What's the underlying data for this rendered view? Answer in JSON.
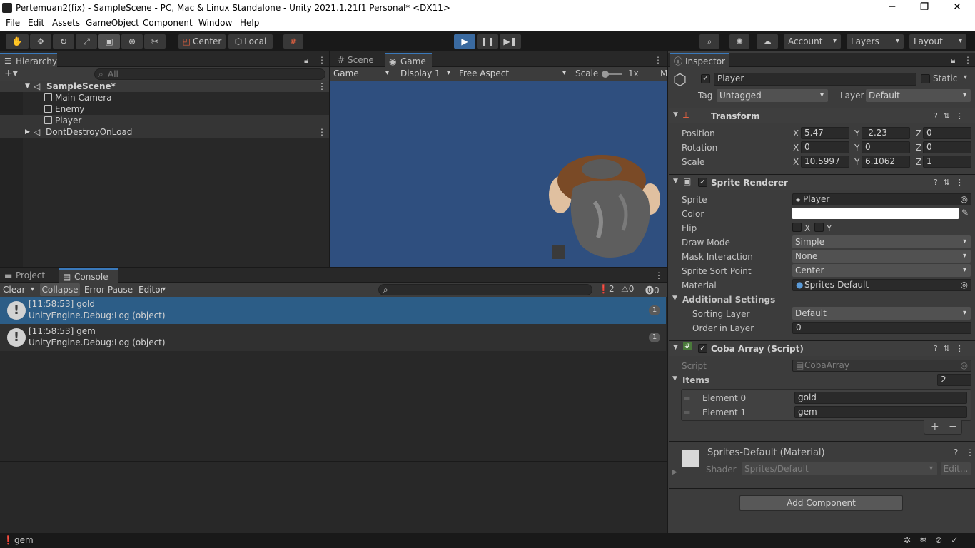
{
  "window": {
    "title": "Pertemuan2(fix) - SampleScene - PC, Mac & Linux Standalone - Unity 2021.1.21f1 Personal* <DX11>",
    "minimize": "─",
    "maximize": "❐",
    "close": "✕"
  },
  "menu": [
    "File",
    "Edit",
    "Assets",
    "GameObject",
    "Component",
    "Window",
    "Help"
  ],
  "toolbar": {
    "center": "Center",
    "local": "Local",
    "account": "Account",
    "layers": "Layers",
    "layout": "Layout"
  },
  "hierarchy": {
    "tab": "Hierarchy",
    "search_placeholder": "All",
    "scene": "SampleScene*",
    "items": [
      "Main Camera",
      "Enemy",
      "Player"
    ],
    "dont_destroy": "DontDestroyOnLoad"
  },
  "game_view": {
    "tab_scene": "Scene",
    "tab_game": "Game",
    "mode": "Game",
    "display": "Display 1",
    "aspect": "Free Aspect",
    "scale_label": "Scale",
    "scale_value": "1x",
    "m": "M",
    "background": "#2f4f7f"
  },
  "console": {
    "tab_project": "Project",
    "tab_console": "Console",
    "clear": "Clear",
    "collapse": "Collapse",
    "error_pause": "Error Pause",
    "editor": "Editor",
    "count_log": "2",
    "count_warn": "0",
    "count_err": "0",
    "entries": [
      {
        "line1": "[11:58:53] gold",
        "line2": "UnityEngine.Debug:Log (object)",
        "count": "1"
      },
      {
        "line1": "[11:58:53] gem",
        "line2": "UnityEngine.Debug:Log (object)",
        "count": "1"
      }
    ]
  },
  "status_bar": {
    "text": "gem"
  },
  "inspector": {
    "tab": "Inspector",
    "object_name": "Player",
    "static_label": "Static",
    "tag_label": "Tag",
    "tag_value": "Untagged",
    "layer_label": "Layer",
    "layer_value": "Default",
    "transform": {
      "title": "Transform",
      "position_label": "Position",
      "position": {
        "x": "5.47",
        "y": "-2.23",
        "z": "0"
      },
      "rotation_label": "Rotation",
      "rotation": {
        "x": "0",
        "y": "0",
        "z": "0"
      },
      "scale_label": "Scale",
      "scale": {
        "x": "10.5997",
        "y": "6.1062",
        "z": "1"
      }
    },
    "sprite_renderer": {
      "title": "Sprite Renderer",
      "sprite_label": "Sprite",
      "sprite_value": "Player",
      "color_label": "Color",
      "flip_label": "Flip",
      "flip_x": "X",
      "flip_y": "Y",
      "draw_mode_label": "Draw Mode",
      "draw_mode_value": "Simple",
      "mask_label": "Mask Interaction",
      "mask_value": "None",
      "sort_point_label": "Sprite Sort Point",
      "sort_point_value": "Center",
      "material_label": "Material",
      "material_value": "Sprites-Default",
      "additional": "Additional Settings",
      "sorting_layer_label": "Sorting Layer",
      "sorting_layer_value": "Default",
      "order_label": "Order in Layer",
      "order_value": "0"
    },
    "coba_array": {
      "title": "Coba Array (Script)",
      "script_label": "Script",
      "script_value": "CobaArray",
      "items_label": "Items",
      "items_count": "2",
      "elements": [
        {
          "label": "Element 0",
          "value": "gold"
        },
        {
          "label": "Element 1",
          "value": "gem"
        }
      ],
      "plus": "+",
      "minus": "−"
    },
    "material": {
      "title": "Sprites-Default (Material)",
      "shader_label": "Shader",
      "shader_value": "Sprites/Default",
      "edit": "Edit..."
    },
    "add_component": "Add Component"
  }
}
